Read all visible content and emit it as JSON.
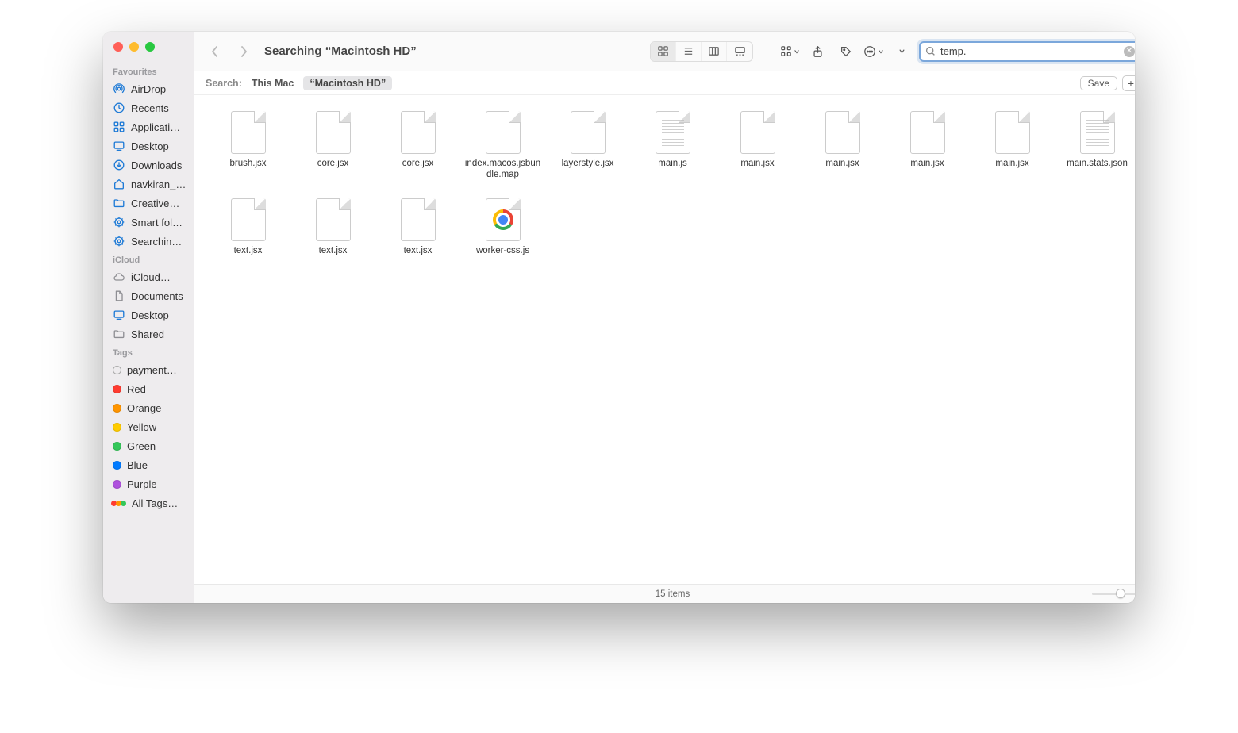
{
  "toolbar": {
    "title": "Searching “Macintosh HD”",
    "search_value": "temp."
  },
  "scope": {
    "label": "Search:",
    "this_mac": "This Mac",
    "active": "“Macintosh HD”",
    "save": "Save"
  },
  "sidebar": {
    "favourites_title": "Favourites",
    "favourites": [
      {
        "label": "AirDrop",
        "icon": "airdrop"
      },
      {
        "label": "Recents",
        "icon": "clock"
      },
      {
        "label": "Applicati…",
        "icon": "apps"
      },
      {
        "label": "Desktop",
        "icon": "desktop"
      },
      {
        "label": "Downloads",
        "icon": "download"
      },
      {
        "label": "navkiran_…",
        "icon": "home"
      },
      {
        "label": "Creative…",
        "icon": "folder"
      },
      {
        "label": "Smart fol…",
        "icon": "gear"
      },
      {
        "label": "Searchin…",
        "icon": "gear"
      }
    ],
    "icloud_title": "iCloud",
    "icloud": [
      {
        "label": "iCloud…",
        "icon": "cloud"
      },
      {
        "label": "Documents",
        "icon": "document"
      },
      {
        "label": "Desktop",
        "icon": "desktop"
      },
      {
        "label": "Shared",
        "icon": "shared"
      }
    ],
    "tags_title": "Tags",
    "tags": [
      {
        "label": "payment…",
        "color": "empty"
      },
      {
        "label": "Red",
        "color": "#ff3b30"
      },
      {
        "label": "Orange",
        "color": "#ff9500"
      },
      {
        "label": "Yellow",
        "color": "#ffcc00"
      },
      {
        "label": "Green",
        "color": "#34c759"
      },
      {
        "label": "Blue",
        "color": "#007aff"
      },
      {
        "label": "Purple",
        "color": "#af52de"
      },
      {
        "label": "All Tags…",
        "color": "all"
      }
    ]
  },
  "files": [
    {
      "name": "brush.jsx",
      "kind": "blank"
    },
    {
      "name": "core.jsx",
      "kind": "blank"
    },
    {
      "name": "core.jsx",
      "kind": "blank"
    },
    {
      "name": "index.macos.jsbundle.map",
      "kind": "blank"
    },
    {
      "name": "layerstyle.jsx",
      "kind": "blank"
    },
    {
      "name": "main.js",
      "kind": "text"
    },
    {
      "name": "main.jsx",
      "kind": "blank"
    },
    {
      "name": "main.jsx",
      "kind": "blank"
    },
    {
      "name": "main.jsx",
      "kind": "blank"
    },
    {
      "name": "main.jsx",
      "kind": "blank"
    },
    {
      "name": "main.stats.json",
      "kind": "text"
    },
    {
      "name": "text.jsx",
      "kind": "blank"
    },
    {
      "name": "text.jsx",
      "kind": "blank"
    },
    {
      "name": "text.jsx",
      "kind": "blank"
    },
    {
      "name": "worker-css.js",
      "kind": "chrome"
    }
  ],
  "status": {
    "text": "15 items"
  }
}
